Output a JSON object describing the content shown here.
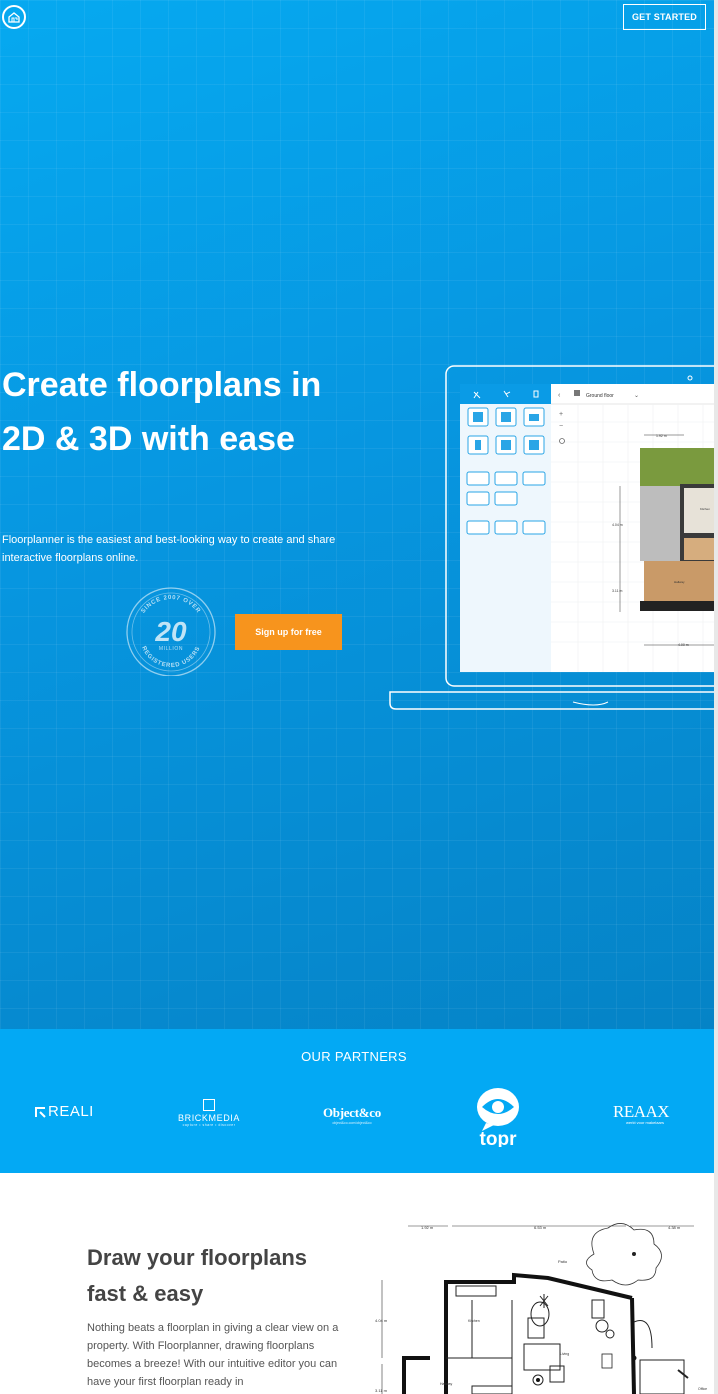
{
  "header": {
    "logo_icon": "floorplanner-house-icon",
    "cta_label": "GET STARTED"
  },
  "hero": {
    "headline": "Create floorplans in 2D & 3D with ease",
    "subline": "Floorplanner is the easiest and best-looking way to create and share interactive floorplans online.",
    "badge": {
      "top_text": "SINCE 2007 OVER",
      "number": "20",
      "unit": "MILLION",
      "bottom_text": "REGISTERED USERS"
    },
    "signup_label": "Sign up for free",
    "editor": {
      "floor_select": "Ground floor",
      "dim_top": "1.92 m",
      "dim_left_1": "4.04 m",
      "dim_left_2": "3.11 m",
      "dim_bottom": "4.00 m",
      "room_label": "Kitchen",
      "room_label_2": "Hallway"
    }
  },
  "partners": {
    "title": "OUR PARTNERS",
    "items": [
      {
        "name": "REALI"
      },
      {
        "name": "BRICKMEDIA",
        "tagline": "capture • share • discover"
      },
      {
        "name": "Object&co",
        "tagline": "object&co.com/object&co"
      },
      {
        "name": "topr"
      },
      {
        "name": "REAAX",
        "tagline": "werkt voor makelaars"
      }
    ]
  },
  "feature": {
    "title": "Draw your floorplans fast & easy",
    "text": "Nothing beats a floorplan in giving a clear view on a property. With Floorplanner, drawing floorplans becomes a breeze! With our intuitive editor you can have your first floorplan ready in",
    "plan_labels": {
      "dim_a": "1.92 m",
      "dim_b": "6.53 m",
      "dim_c": "4.38 m",
      "dim_left": "4.04 m",
      "dim_left_2": "3.11 m",
      "room_patio": "Patio",
      "room_kitchen": "Kitchen",
      "room_living": "Living",
      "room_hallway": "Hallway",
      "room_office": "Office"
    }
  },
  "colors": {
    "hero_blue": "#0796e0",
    "partner_blue": "#03a9f4",
    "signup_orange": "#f7941d"
  }
}
